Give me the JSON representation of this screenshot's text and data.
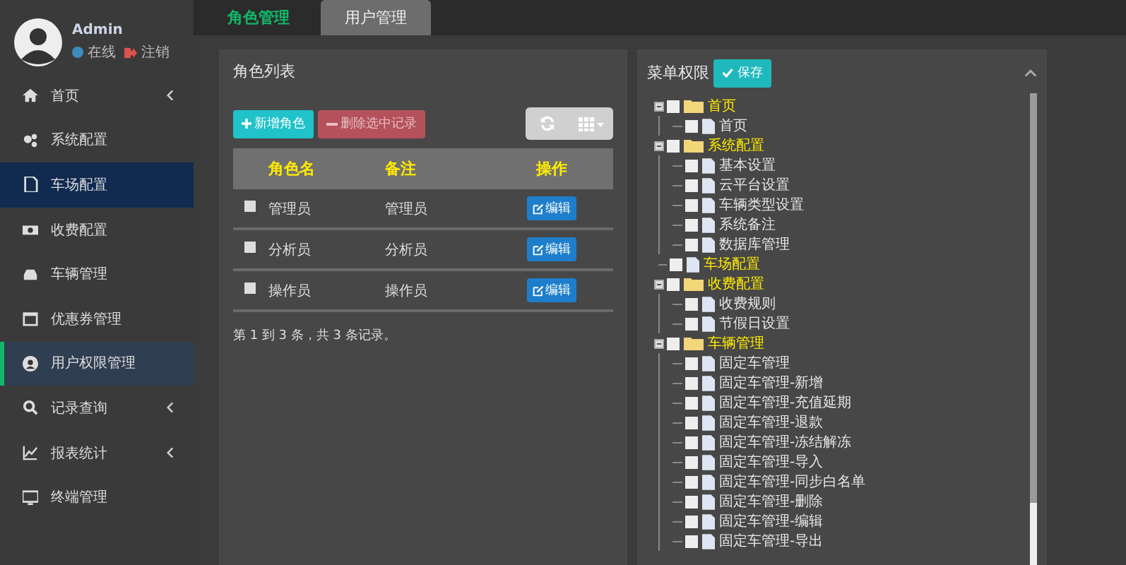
{
  "user": {
    "name": "Admin",
    "status": "在线",
    "logout": "注销"
  },
  "sidebar": {
    "items": [
      {
        "label": "首页",
        "caret": true,
        "selected": false,
        "hovered": false
      },
      {
        "label": "系统配置",
        "caret": false,
        "selected": false,
        "hovered": false
      },
      {
        "label": "车场配置",
        "caret": false,
        "selected": false,
        "hovered": true
      },
      {
        "label": "收费配置",
        "caret": false,
        "selected": false,
        "hovered": false
      },
      {
        "label": "车辆管理",
        "caret": false,
        "selected": false,
        "hovered": false
      },
      {
        "label": "优惠券管理",
        "caret": false,
        "selected": false,
        "hovered": false
      },
      {
        "label": "用户权限管理",
        "caret": false,
        "selected": true,
        "hovered": false
      },
      {
        "label": "记录查询",
        "caret": true,
        "selected": false,
        "hovered": false
      },
      {
        "label": "报表统计",
        "caret": true,
        "selected": false,
        "hovered": false
      },
      {
        "label": "终端管理",
        "caret": false,
        "selected": false,
        "hovered": false
      }
    ]
  },
  "tabs": [
    {
      "label": "角色管理",
      "selected": true
    },
    {
      "label": "用户管理",
      "selected": false
    }
  ],
  "role_panel": {
    "title": "角色列表",
    "add_button": "新增角色",
    "delete_button": "删除选中记录",
    "table": {
      "columns": [
        "角色名",
        "备注",
        "操作"
      ],
      "rows": [
        {
          "checked": false,
          "name": "管理员",
          "note": "管理员",
          "action": "编辑"
        },
        {
          "checked": false,
          "name": "分析员",
          "note": "分析员",
          "action": "编辑"
        },
        {
          "checked": false,
          "name": "操作员",
          "note": "操作员",
          "action": "编辑"
        }
      ]
    },
    "pagination": "第 1 到 3 条，共 3 条记录。"
  },
  "menu_panel": {
    "title": "菜单权限",
    "save_button": "保存",
    "tree": [
      {
        "label": "首页",
        "checked": false,
        "expanded": true,
        "children": [
          {
            "label": "首页",
            "checked": false
          }
        ]
      },
      {
        "label": "系统配置",
        "checked": false,
        "expanded": true,
        "children": [
          {
            "label": "基本设置",
            "checked": false
          },
          {
            "label": "云平台设置",
            "checked": false
          },
          {
            "label": "车辆类型设置",
            "checked": false
          },
          {
            "label": "系统备注",
            "checked": false
          },
          {
            "label": "数据库管理",
            "checked": false
          }
        ]
      },
      {
        "label": "车场配置",
        "checked": false
      },
      {
        "label": "收费配置",
        "checked": false,
        "expanded": true,
        "children": [
          {
            "label": "收费规则",
            "checked": false
          },
          {
            "label": "节假日设置",
            "checked": false
          }
        ]
      },
      {
        "label": "车辆管理",
        "checked": false,
        "expanded": true,
        "children": [
          {
            "label": "固定车管理",
            "checked": false
          },
          {
            "label": "固定车管理-新增",
            "checked": false
          },
          {
            "label": "固定车管理-充值延期",
            "checked": false
          },
          {
            "label": "固定车管理-退款",
            "checked": false
          },
          {
            "label": "固定车管理-冻结解冻",
            "checked": false
          },
          {
            "label": "固定车管理-导入",
            "checked": false
          },
          {
            "label": "固定车管理-同步白名单",
            "checked": false
          },
          {
            "label": "固定车管理-删除",
            "checked": false
          },
          {
            "label": "固定车管理-编辑",
            "checked": false
          },
          {
            "label": "固定车管理-导出",
            "checked": false
          }
        ]
      }
    ]
  }
}
